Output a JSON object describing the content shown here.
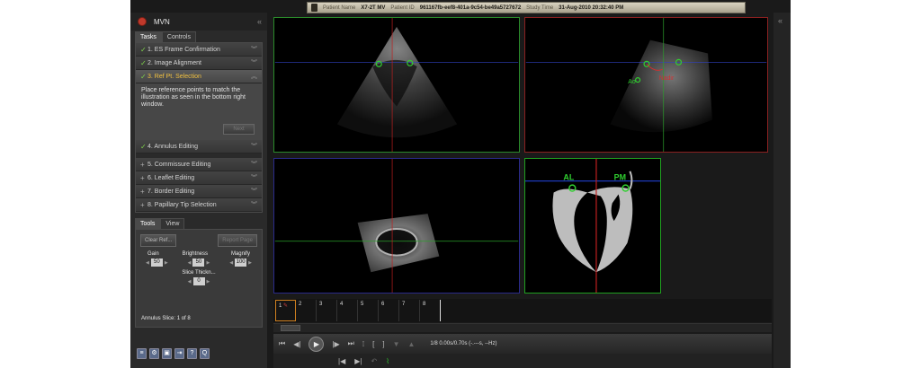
{
  "patient_bar": {
    "name_label": "Patient Name",
    "name": "X7-2T MV",
    "id_label": "Patient ID",
    "id": "961167fb-eef8-401a-9c54-be49a5727672",
    "time_label": "Study Time",
    "time": "31-Aug-2010 20:32:40 PM"
  },
  "app": {
    "title": "MVN"
  },
  "left_tabs": [
    "Tasks",
    "Controls"
  ],
  "tasks": [
    {
      "label": "1. ES Frame Confirmation",
      "state": "done"
    },
    {
      "label": "2. Image Alignment",
      "state": "done"
    },
    {
      "label": "3. Ref Pt. Selection",
      "state": "active"
    },
    {
      "label": "4. Annulus Editing",
      "state": "done"
    },
    {
      "label": "5. Commissure Editing",
      "state": "pending"
    },
    {
      "label": "6. Leaflet Editing",
      "state": "pending"
    },
    {
      "label": "7. Border Editing",
      "state": "pending"
    },
    {
      "label": "8. Papillary Tip Selection",
      "state": "pending"
    }
  ],
  "task_instructions": "Place reference points to match the illustration as seen in the bottom right window.",
  "next_label": "Next",
  "tool_tabs": [
    "Tools",
    "View"
  ],
  "tools": {
    "clear_label": "Clear Ref...",
    "report_label": "Report Page",
    "gain_label": "Gain",
    "gain": "50",
    "brightness_label": "Brightness",
    "brightness": "50",
    "magnify_label": "Magnify",
    "magnify": "100",
    "slice_label": "Slice Thickn...",
    "slice": "0",
    "status": "Annulus Slice: 1 of 8"
  },
  "views": {
    "v2_labels": {
      "ao": "Ao",
      "nadir": "Nadir"
    },
    "diagram": {
      "al": "AL",
      "pm": "PM"
    }
  },
  "frames": [
    "1",
    "2",
    "3",
    "4",
    "5",
    "6",
    "7",
    "8"
  ],
  "transport_info": "1/8  0.00s/0.70s (-.---s, --Hz)",
  "colors": {
    "accent_orange": "#d08020",
    "green": "#20c020",
    "red": "#c02020",
    "blue": "#2040c0"
  }
}
